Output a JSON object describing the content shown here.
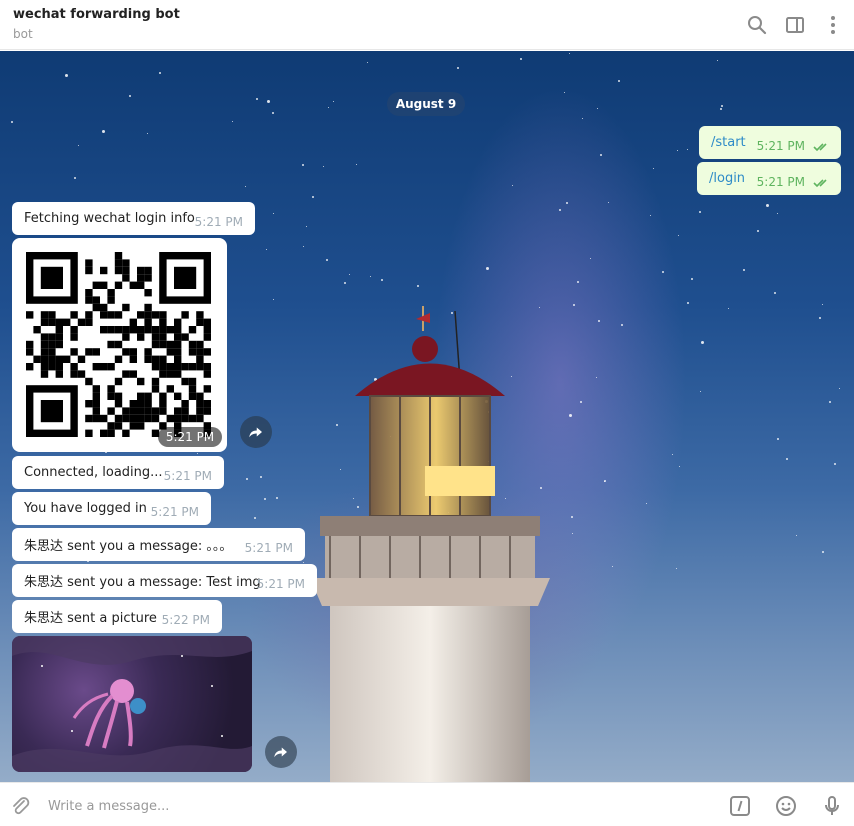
{
  "header": {
    "title": "wechat forwarding bot",
    "subtitle": "bot",
    "icons": [
      "search-icon",
      "sidebar-toggle-icon",
      "more-vertical-icon"
    ]
  },
  "chat": {
    "date_label": "August 9",
    "outgoing": [
      {
        "text": "/start",
        "time": "5:21 PM",
        "status": "read"
      },
      {
        "text": "/login",
        "time": "5:21 PM",
        "status": "read"
      }
    ],
    "incoming": [
      {
        "text": "Fetching wechat login info",
        "time": "5:21 PM"
      },
      {
        "text": "Connected, loading...",
        "time": "5:21 PM"
      },
      {
        "text": "You have logged in",
        "time": "5:21 PM"
      },
      {
        "text": "朱思达 sent you a message: 。。。",
        "time": "5:21 PM"
      },
      {
        "text": "朱思达 sent you a message: Test img",
        "time": "5:21 PM"
      },
      {
        "text": "朱思达 sent a picture",
        "time": "5:22 PM"
      }
    ],
    "qr_time": "5:21 PM"
  },
  "composer": {
    "placeholder": "Write a message...",
    "icons": [
      "attach-icon",
      "commands-icon",
      "emoji-icon",
      "microphone-icon"
    ]
  },
  "colors": {
    "outgoing_bubble": "#effdde",
    "outgoing_text": "#2e8bc8",
    "read_check": "#5fb45f",
    "icon_gray": "#8a8a8a"
  }
}
